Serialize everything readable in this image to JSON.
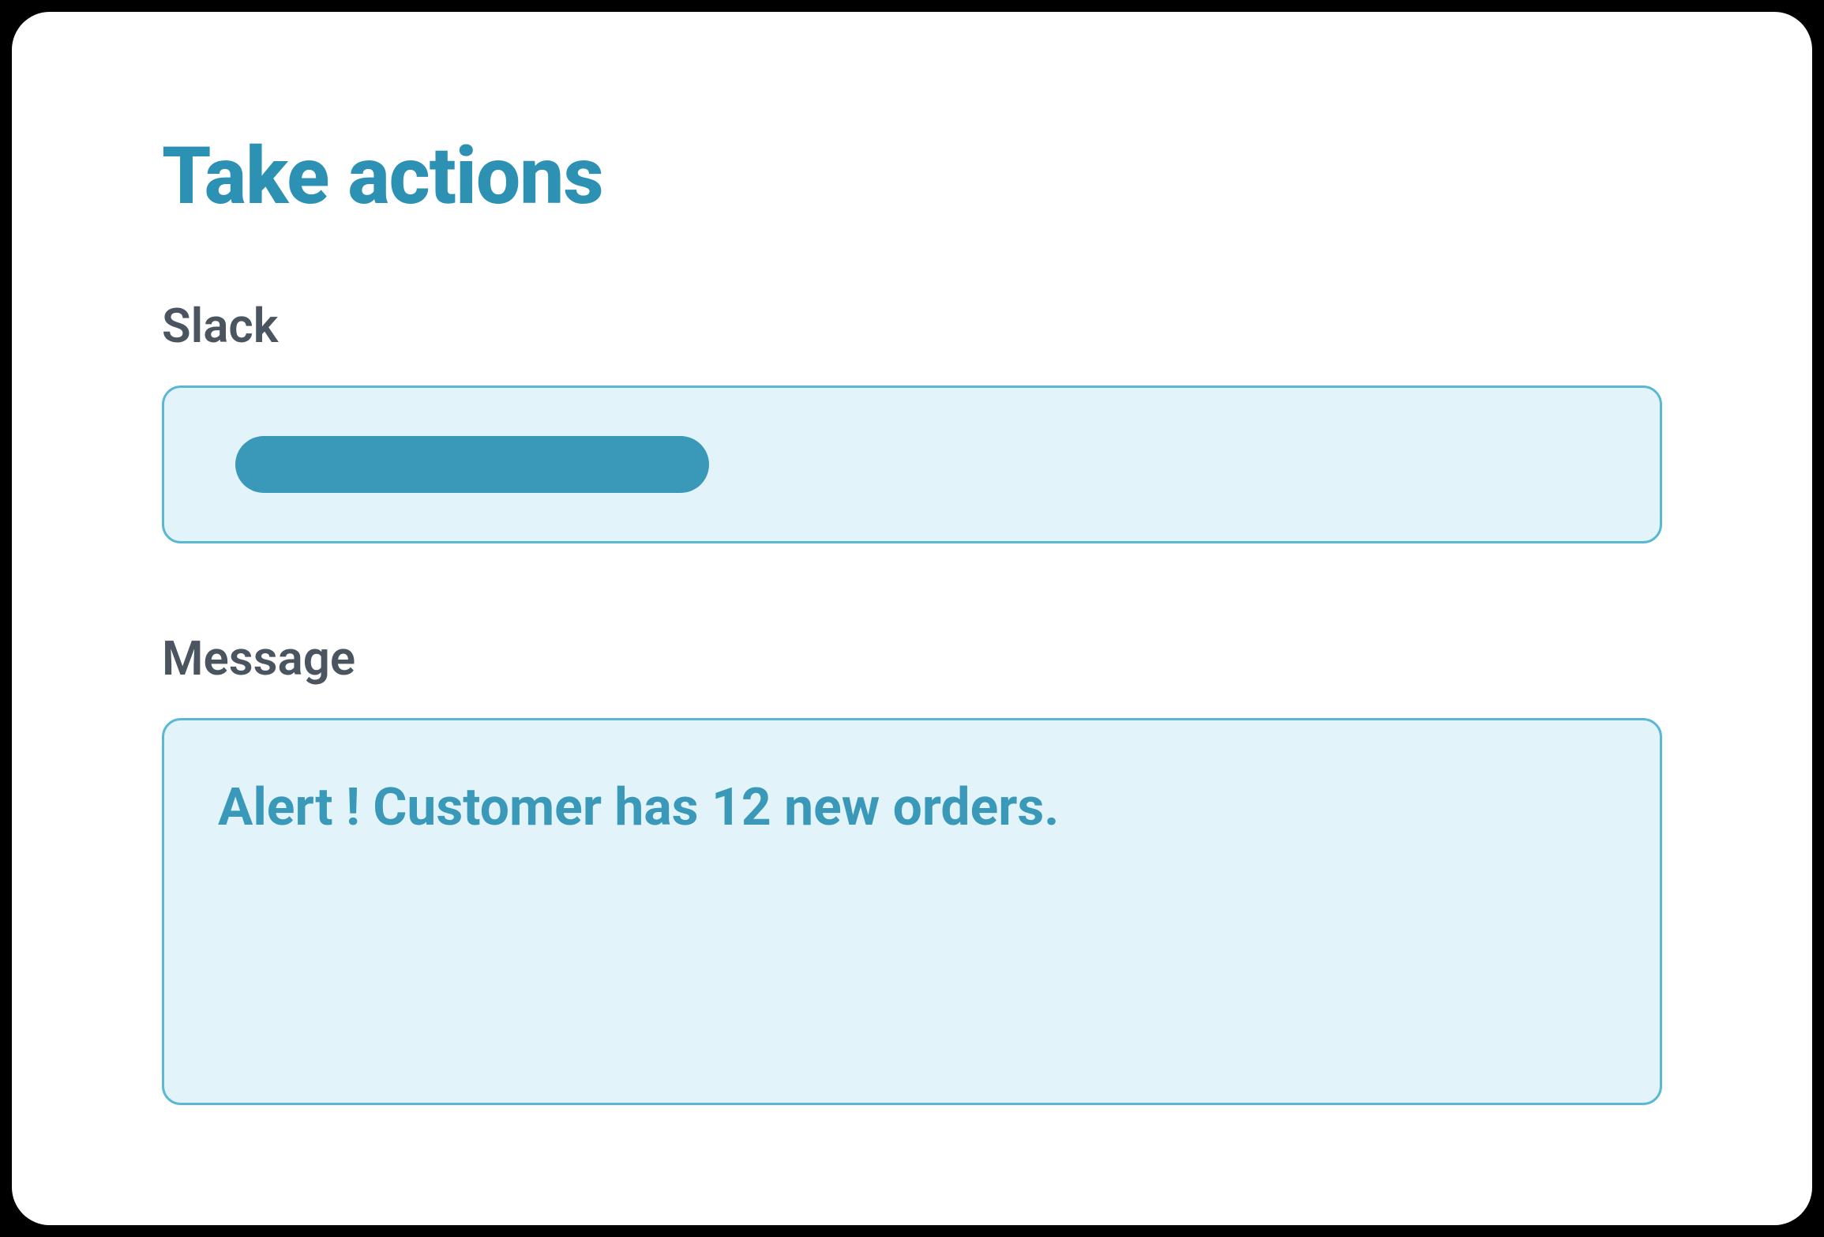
{
  "panel": {
    "title": "Take actions"
  },
  "fields": {
    "slack": {
      "label": "Slack"
    },
    "message": {
      "label": "Message",
      "value": "Alert ! Customer has 12 new orders."
    }
  },
  "colors": {
    "accent": "#2d91b3",
    "field_bg": "#e2f4fa",
    "field_border": "#5bb8d4",
    "field_text": "#3a99b8",
    "label": "#4a5560"
  }
}
